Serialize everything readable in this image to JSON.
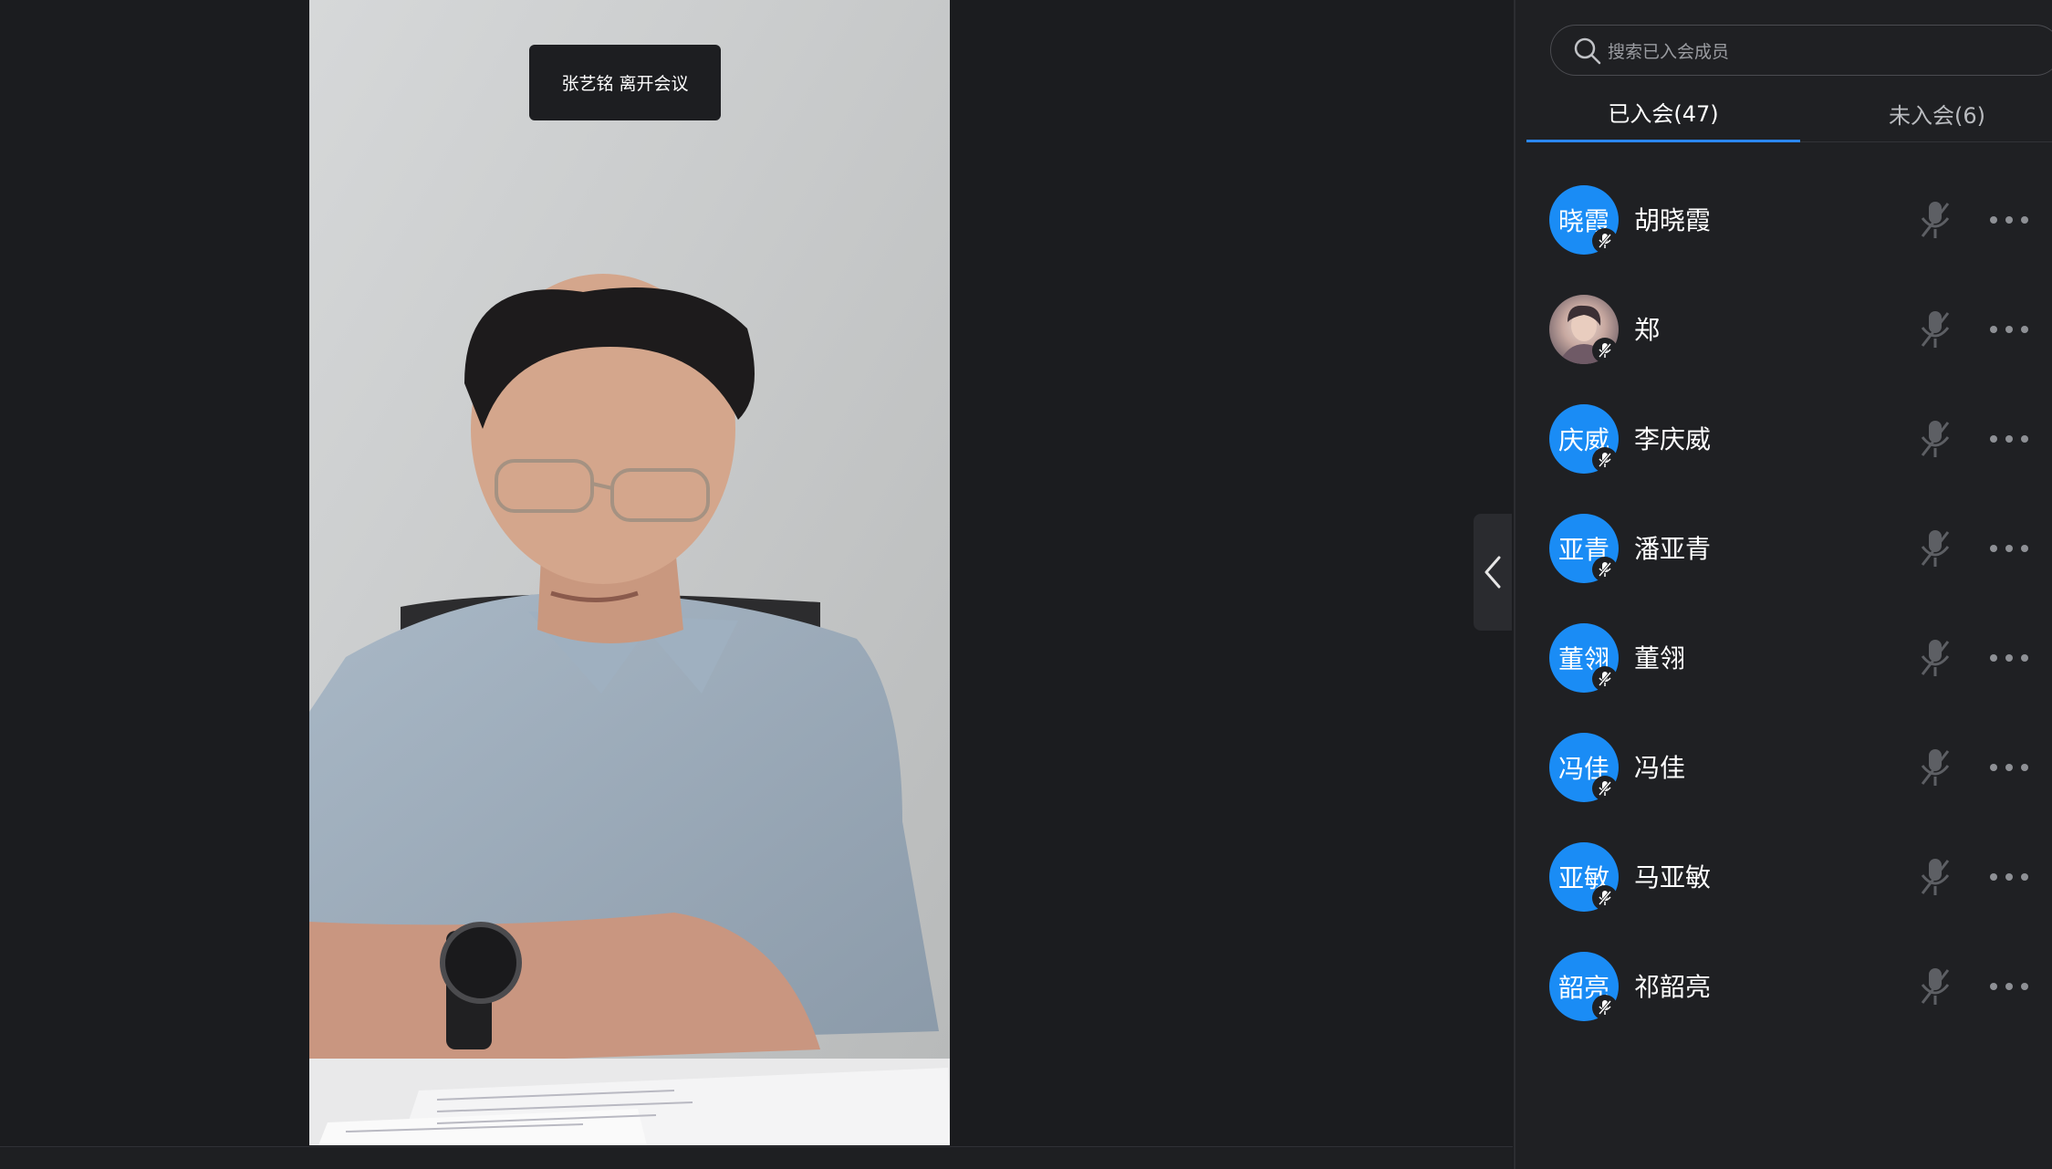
{
  "video": {
    "notification": "张艺铭 离开会议"
  },
  "panel": {
    "search_placeholder": "搜索已入会成员",
    "tabs": [
      {
        "label": "已入会(47)",
        "active": true
      },
      {
        "label": "未入会(6)",
        "active": false
      }
    ],
    "participants": [
      {
        "avatar_text": "晓霞",
        "name": "胡晓霞",
        "avatar": "initials"
      },
      {
        "avatar_text": "",
        "name": "郑",
        "avatar": "photo"
      },
      {
        "avatar_text": "庆威",
        "name": "李庆威",
        "avatar": "initials"
      },
      {
        "avatar_text": "亚青",
        "name": "潘亚青",
        "avatar": "initials"
      },
      {
        "avatar_text": "董翎",
        "name": "董翎",
        "avatar": "initials"
      },
      {
        "avatar_text": "冯佳",
        "name": "冯佳",
        "avatar": "initials"
      },
      {
        "avatar_text": "亚敏",
        "name": "马亚敏",
        "avatar": "initials"
      },
      {
        "avatar_text": "韶亮",
        "name": "祁韶亮",
        "avatar": "initials"
      }
    ]
  },
  "colors": {
    "accent": "#2b87f2",
    "avatar_bg": "#1a8cf5",
    "panel_bg": "#1f2023",
    "stage_bg": "#1b1c1f"
  }
}
